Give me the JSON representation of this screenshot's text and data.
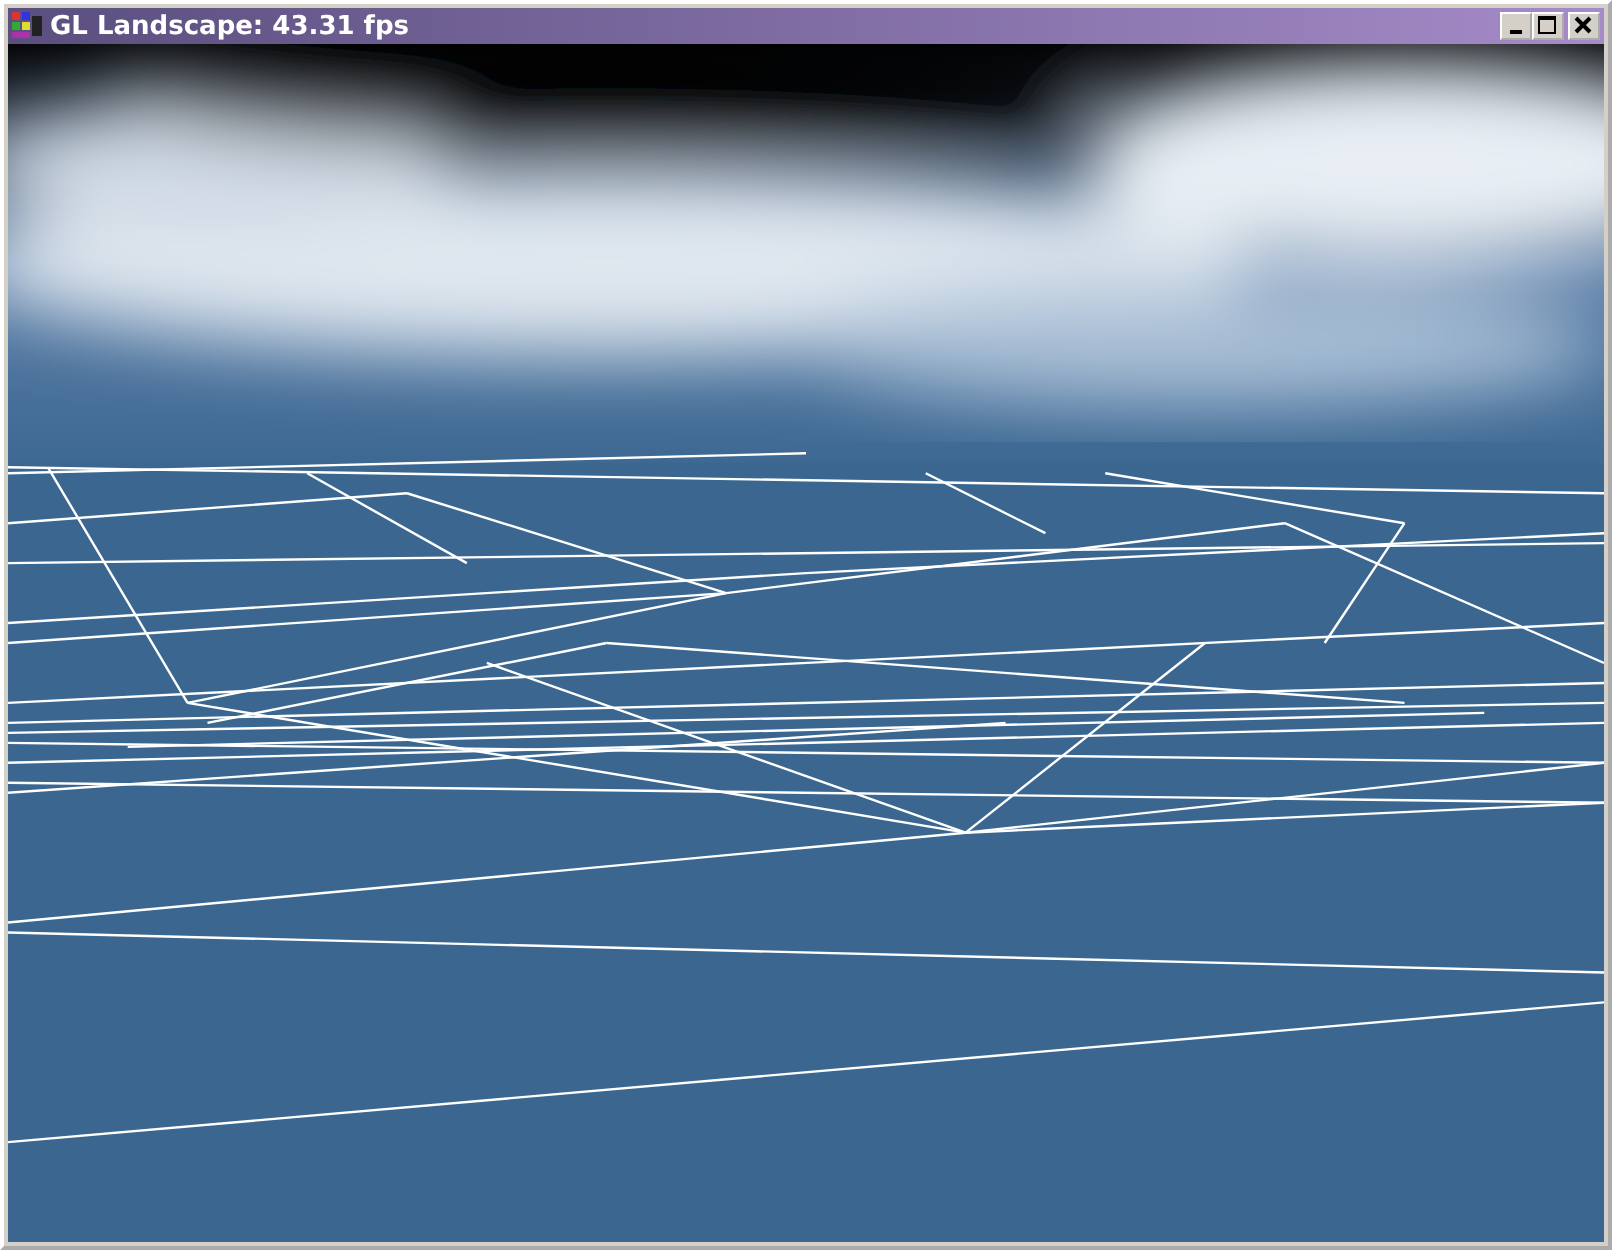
{
  "window": {
    "title": "GL Landscape: 43.31 fps"
  }
}
